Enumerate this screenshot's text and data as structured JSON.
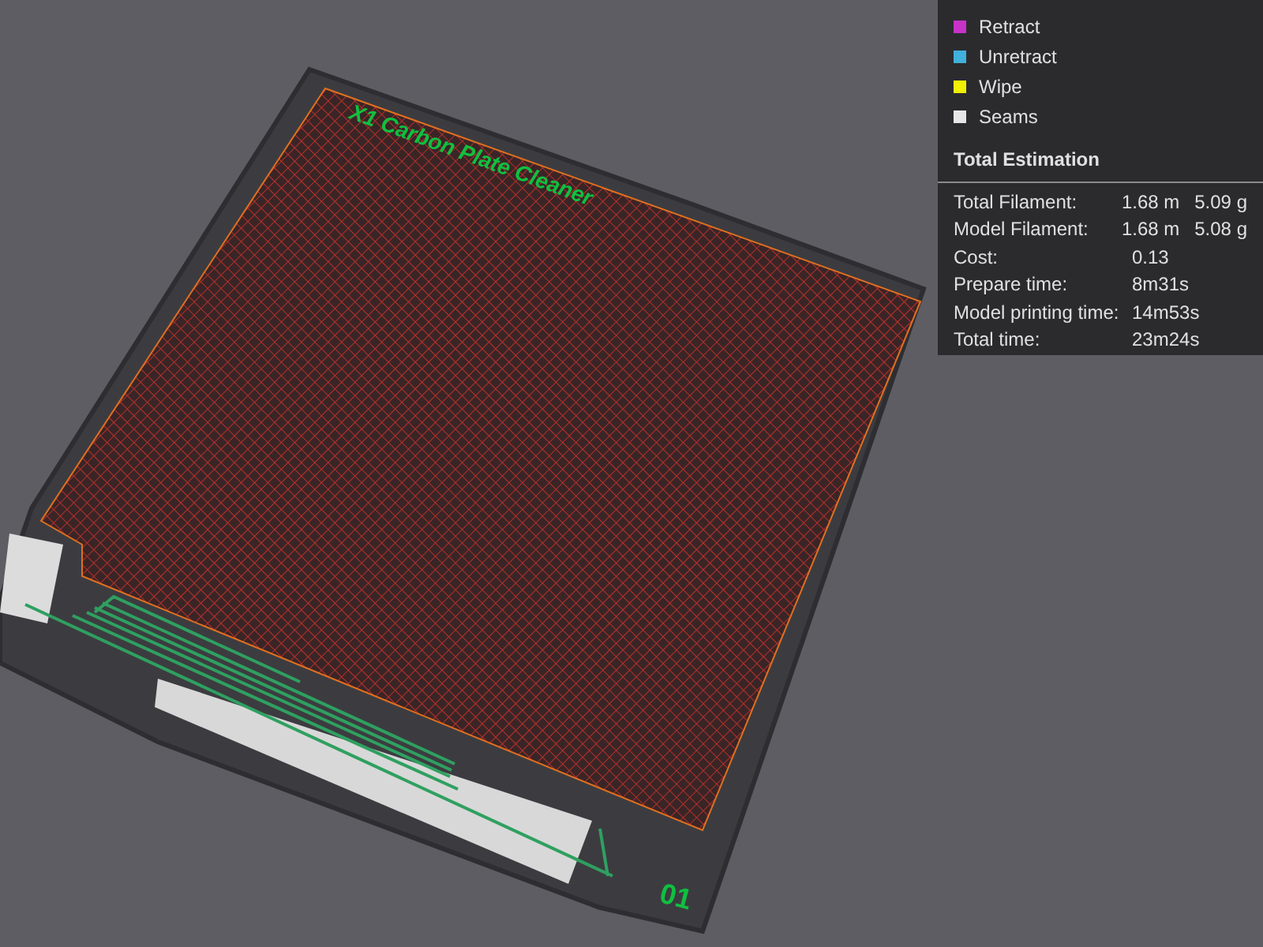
{
  "viewport": {
    "plate_label": "X1 Carbon Plate Cleaner",
    "plate_number": "01"
  },
  "legend": {
    "items": [
      {
        "label": "Retract",
        "color": "#c832c8"
      },
      {
        "label": "Unretract",
        "color": "#40b0dc"
      },
      {
        "label": "Wipe",
        "color": "#f0f000"
      },
      {
        "label": "Seams",
        "color": "#e6e6e6"
      }
    ],
    "estimation": {
      "title": "Total Estimation",
      "rows": [
        {
          "label": "Total Filament:",
          "value": "1.68 m",
          "value_2": "5.09 g"
        },
        {
          "label": "Model Filament:",
          "value": "1.68 m",
          "value_2": "5.08 g"
        },
        {
          "label": "Cost:",
          "value": "0.13"
        },
        {
          "label": "Prepare time:",
          "value": "8m31s"
        },
        {
          "label": "Model printing time:",
          "value": "14m53s"
        },
        {
          "label": "Total time:",
          "value": "23m24s"
        }
      ]
    }
  }
}
